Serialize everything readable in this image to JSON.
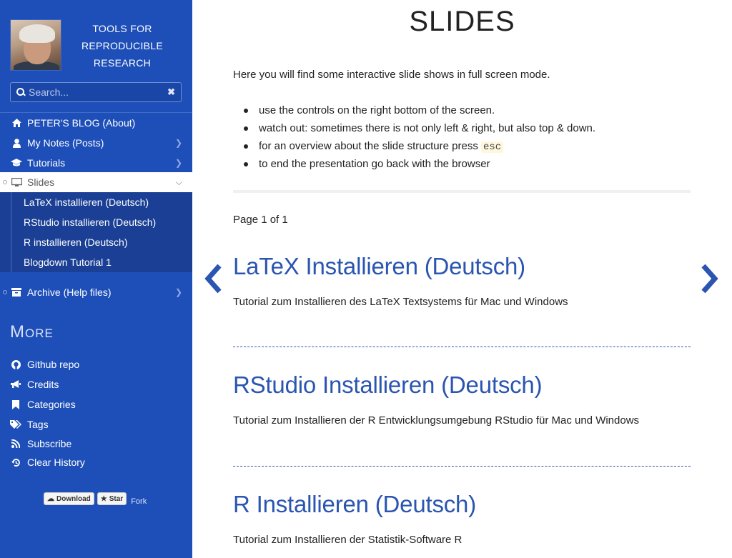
{
  "sidebar": {
    "site_title": "TOOLS FOR REPRODUCIBLE RESEARCH",
    "search_placeholder": "Search...",
    "nav": [
      {
        "label": "PETER'S BLOG (About)",
        "icon": "home-icon"
      },
      {
        "label": "My Notes (Posts)",
        "icon": "user-icon"
      },
      {
        "label": "Tutorials",
        "icon": "graduation-cap-icon"
      },
      {
        "label": "Slides",
        "icon": "monitor-icon",
        "active": true
      },
      {
        "label": "Archive (Help files)",
        "icon": "archive-icon"
      }
    ],
    "slides_submenu": [
      "LaTeX installieren (Deutsch)",
      "RStudio installieren (Deutsch)",
      "R installieren (Deutsch)",
      "Blogdown Tutorial 1"
    ],
    "more_heading": "More",
    "more_links": [
      {
        "label": "Github repo",
        "icon": "github-icon"
      },
      {
        "label": "Credits",
        "icon": "bullhorn-icon"
      },
      {
        "label": "Categories",
        "icon": "bookmark-icon"
      },
      {
        "label": "Tags",
        "icon": "tags-icon"
      },
      {
        "label": "Subscribe",
        "icon": "rss-icon"
      },
      {
        "label": "Clear History",
        "icon": "history-icon"
      }
    ],
    "github_buttons": {
      "download": "Download",
      "star": "Star",
      "fork": "Fork"
    }
  },
  "main": {
    "title": "SLIDES",
    "intro": "Here you will find some interactive slide shows in full screen mode.",
    "tips": {
      "t1": "use the controls on the right bottom of the screen.",
      "t2": "watch out: sometimes there is not only left & right, but also top & down.",
      "t3": "for an overview about the slide structure press",
      "t3_key": "esc",
      "t4": "to end the presentation go back with the browser"
    },
    "pager": "Page 1 of 1",
    "posts": [
      {
        "title": "LaTeX Installieren (Deutsch)",
        "summary": "Tutorial zum Installieren des LaTeX Textsystems für Mac und Windows"
      },
      {
        "title": "RStudio Installieren (Deutsch)",
        "summary": "Tutorial zum Installieren der R Entwicklungsumgebung RStudio für Mac und Windows"
      },
      {
        "title": "R Installieren (Deutsch)",
        "summary": "Tutorial zum Installieren der Statistik-Software R"
      }
    ]
  },
  "colors": {
    "sidebar_bg": "#1e4fb8",
    "link": "#2a55b0"
  }
}
